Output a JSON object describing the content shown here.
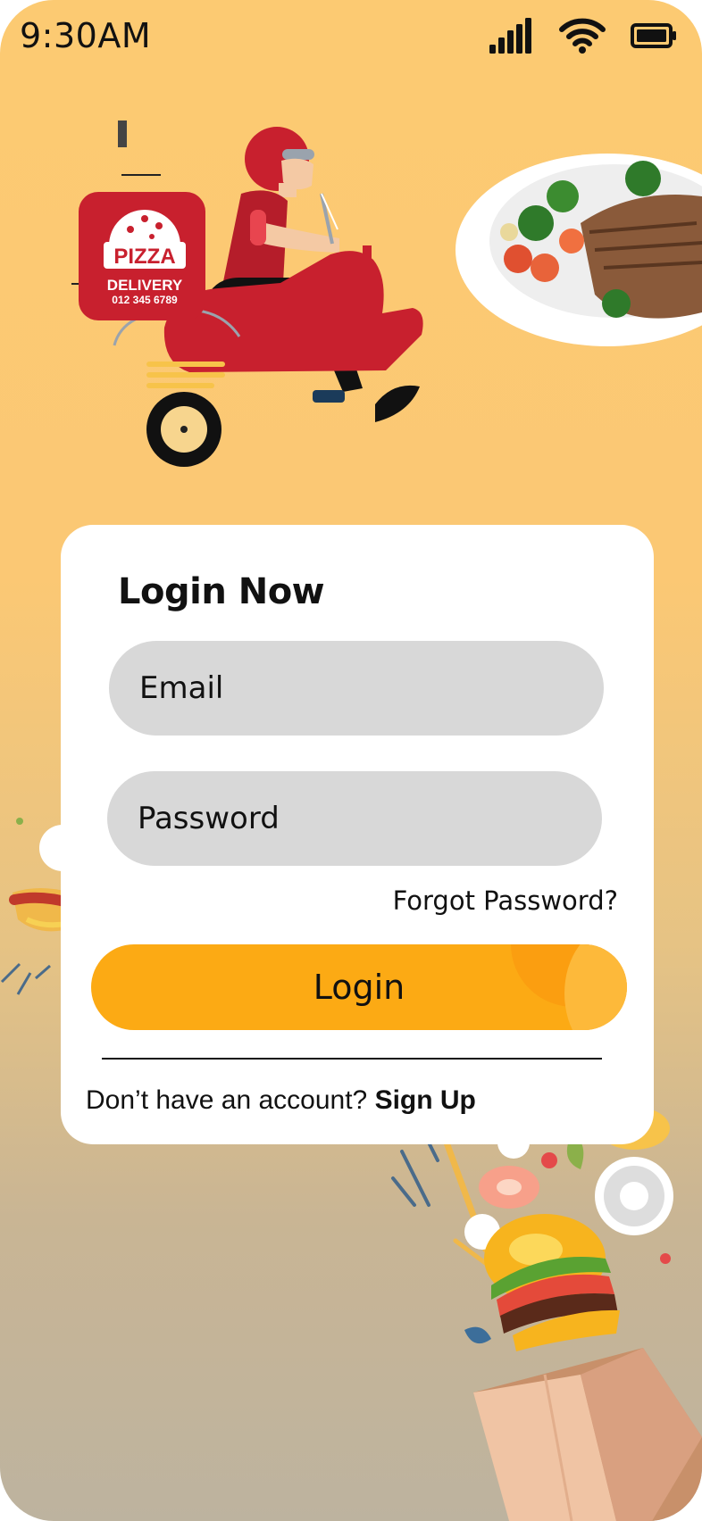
{
  "status_bar": {
    "time": "9:30AM",
    "icons": [
      "signal-icon",
      "wifi-icon",
      "battery-icon"
    ]
  },
  "illustrations": {
    "delivery_box_brand": "PIZZA",
    "delivery_box_label": "DELIVERY",
    "delivery_box_phone": "012 345 6789"
  },
  "login_card": {
    "title": "Login Now",
    "email_placeholder": "Email",
    "email_value": "",
    "password_placeholder": "Password",
    "password_value": "",
    "forgot_password": "Forgot Password?",
    "login_button": "Login",
    "signup_prompt": "Don’t have an account?",
    "signup_link": "Sign Up"
  },
  "colors": {
    "accent": "#fcaa14",
    "background_top": "#fcca72",
    "background_bottom": "#bdb39f",
    "field": "#d8d8d8",
    "scooter_red": "#c8202e"
  }
}
